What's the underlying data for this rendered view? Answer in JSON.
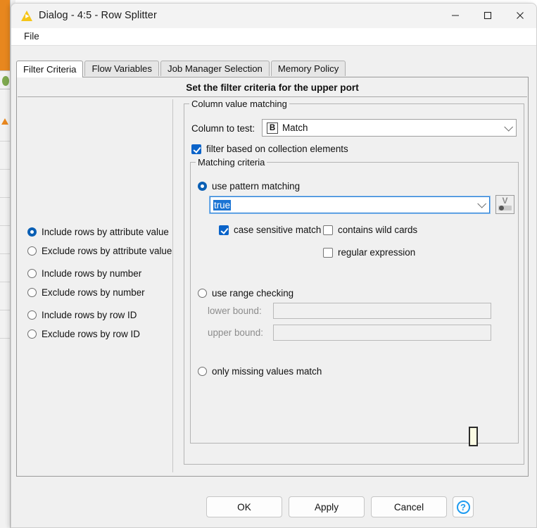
{
  "window": {
    "title": "Dialog - 4:5 - Row Splitter",
    "app_icon": "knime-triangle-icon",
    "minimize_label": "—",
    "maximize_label": "□",
    "close_label": "✕"
  },
  "menubar": {
    "items": [
      {
        "label": "File"
      }
    ]
  },
  "tabs": [
    {
      "label": "Filter Criteria",
      "active": true
    },
    {
      "label": "Flow Variables",
      "active": false
    },
    {
      "label": "Job Manager Selection",
      "active": false
    },
    {
      "label": "Memory Policy",
      "active": false
    }
  ],
  "banner": {
    "title": "Set the filter criteria for the upper port"
  },
  "filter_mode": {
    "selected": "Include rows by attribute value",
    "options": [
      {
        "label": "Include rows by attribute value",
        "selected": true
      },
      {
        "label": "Exclude rows by attribute value",
        "selected": false
      },
      {
        "label": "Include rows by number",
        "selected": false
      },
      {
        "label": "Exclude rows by number",
        "selected": false
      },
      {
        "label": "Include rows by row ID",
        "selected": false
      },
      {
        "label": "Exclude rows by row ID",
        "selected": false
      }
    ]
  },
  "column_value_matching": {
    "group_title": "Column value matching",
    "column_to_test": {
      "label": "Column to test:",
      "type_badge": "B",
      "value": "Match"
    },
    "collection_checkbox": {
      "label": "filter based on collection elements",
      "checked": true
    },
    "matching_criteria": {
      "group_title": "Matching criteria",
      "pattern_matching": {
        "label": "use pattern matching",
        "selected": true,
        "pattern_value": "true",
        "variable_button": "flow-variable-icon",
        "case_sensitive": {
          "label": "case sensitive match",
          "checked": true
        },
        "contains_wild_cards": {
          "label": "contains wild cards",
          "checked": false
        },
        "regular_expression": {
          "label": "regular expression",
          "checked": false
        }
      },
      "range_checking": {
        "label": "use range checking",
        "selected": false,
        "lower_bound": {
          "label": "lower bound:",
          "value": "",
          "enabled": false
        },
        "upper_bound": {
          "label": "upper bound:",
          "value": "",
          "enabled": false
        }
      },
      "missing_values": {
        "label": "only missing values match",
        "selected": false
      }
    }
  },
  "buttons": {
    "ok": "OK",
    "apply": "Apply",
    "cancel": "Cancel",
    "help": "?"
  },
  "colors": {
    "accent_blue": "#0a5fb4",
    "checkbox_blue": "#0a63c9",
    "selection_blue": "#1b74d4",
    "help_blue": "#1e9bf0",
    "knime_yellow": "#f5c518",
    "dialog_bg": "#f0f0f0"
  }
}
